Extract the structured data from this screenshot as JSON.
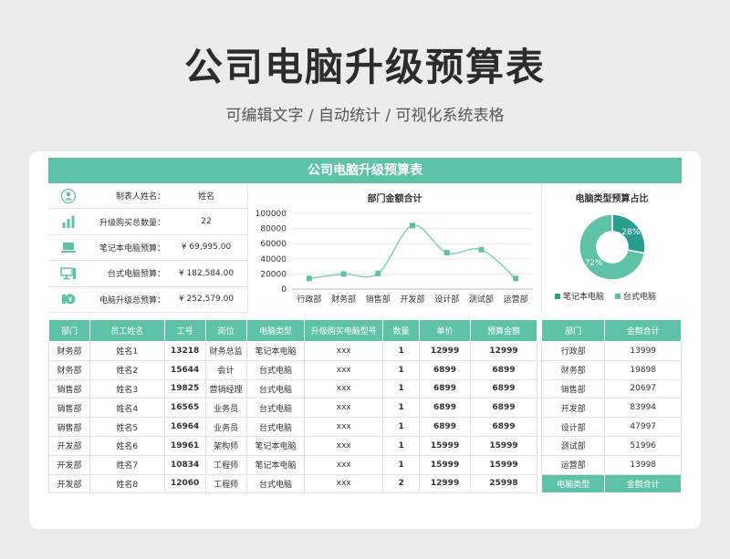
{
  "header": {
    "title": "公司电脑升级预算表",
    "subtitle": "可编辑文字 / 自动统计 / 可视化系统表格"
  },
  "sheet": {
    "banner": "公司电脑升级预算表",
    "info": [
      {
        "icon": "user-icon",
        "label": "制表人姓名：",
        "value": "姓名"
      },
      {
        "icon": "bar-chart-icon",
        "label": "升级购买总数量：",
        "value": "22"
      },
      {
        "icon": "laptop-icon",
        "label": "笔记本电脑预算：",
        "value": "¥ 69,995.00"
      },
      {
        "icon": "desktop-icon",
        "label": "台式电脑预算：",
        "value": "¥ 182,584.00"
      },
      {
        "icon": "coin-icon",
        "label": "电脑升级总预算：",
        "value": "¥ 252,579.00"
      }
    ]
  },
  "colors": {
    "accent": "#5ec2a8",
    "accent_dark": "#2a9d8f",
    "line": "#7dd1bb"
  },
  "chart_data": [
    {
      "type": "line",
      "title": "部门金额合计",
      "categories": [
        "行政部",
        "财务部",
        "销售部",
        "开发部",
        "设计部",
        "测试部",
        "运营部"
      ],
      "values": [
        13999,
        19898,
        20697,
        83994,
        47997,
        51996,
        13998
      ],
      "ylim": [
        0,
        100000
      ],
      "yticks": [
        "0",
        "20000",
        "40000",
        "60000",
        "80000",
        "100000"
      ],
      "grid": true
    },
    {
      "type": "pie",
      "title": "电脑类型预算占比",
      "categories": [
        "笔记本电脑",
        "台式电脑"
      ],
      "values": [
        28,
        72
      ],
      "labels": [
        "28%",
        "72%"
      ],
      "legend": "bottom"
    }
  ],
  "table": {
    "headers": [
      "部门",
      "员工姓名",
      "工号",
      "岗位",
      "电脑类型",
      "升级购买电脑型号",
      "数量",
      "单价",
      "预算金额"
    ],
    "rows": [
      [
        "财务部",
        "姓名1",
        "13218",
        "财务总监",
        "笔记本电脑",
        "xxx",
        "1",
        "12999",
        "12999"
      ],
      [
        "财务部",
        "姓名2",
        "15644",
        "会计",
        "台式电脑",
        "xxx",
        "1",
        "6899",
        "6899"
      ],
      [
        "销售部",
        "姓名3",
        "19825",
        "营销经理",
        "台式电脑",
        "xxx",
        "1",
        "6899",
        "6899"
      ],
      [
        "销售部",
        "姓名4",
        "16565",
        "业务员",
        "台式电脑",
        "xxx",
        "1",
        "6899",
        "6899"
      ],
      [
        "销售部",
        "姓名5",
        "16964",
        "业务员",
        "台式电脑",
        "xxx",
        "1",
        "6899",
        "6899"
      ],
      [
        "开发部",
        "姓名6",
        "19961",
        "架构师",
        "笔记本电脑",
        "xxx",
        "1",
        "15999",
        "15999"
      ],
      [
        "开发部",
        "姓名7",
        "10834",
        "工程师",
        "笔记本电脑",
        "xxx",
        "1",
        "15999",
        "15999"
      ],
      [
        "开发部",
        "姓名8",
        "12060",
        "工程师",
        "台式电脑",
        "xxx",
        "2",
        "12999",
        "25998"
      ]
    ]
  },
  "side_table": {
    "headers": [
      "部门",
      "金额合计"
    ],
    "rows": [
      [
        "行政部",
        "13999"
      ],
      [
        "财务部",
        "19898"
      ],
      [
        "销售部",
        "20697"
      ],
      [
        "开发部",
        "83994"
      ],
      [
        "设计部",
        "47997"
      ],
      [
        "测试部",
        "51996"
      ],
      [
        "运营部",
        "13998"
      ]
    ],
    "footer": [
      "电脑类型",
      "金额合计"
    ]
  }
}
